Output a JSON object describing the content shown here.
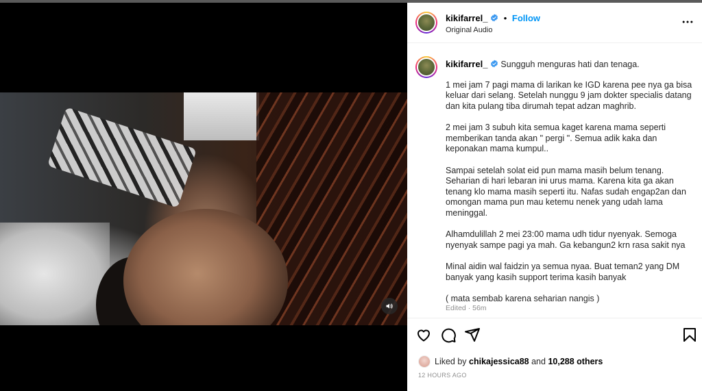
{
  "post": {
    "username": "kikifarrel_",
    "follow_label": "Follow",
    "header_separator": "•",
    "audio": "Original Audio",
    "caption": {
      "first": "Sungguh menguras hati dan tenaga.",
      "paragraphs": [
        "1 mei jam 7 pagi mama di larikan ke IGD karena pee nya ga bisa keluar dari selang. Setelah nunggu 9 jam dokter specialis datang dan kita pulang tiba dirumah tepat adzan maghrib.",
        "2 mei jam 3 subuh kita semua kaget karena mama seperti memberikan tanda akan \" pergi \". Semua adik kaka dan keponakan mama kumpul..",
        "Sampai setelah solat eid pun mama masih belum tenang. Seharian di hari lebaran ini urus mama. Karena kita ga akan tenang klo mama masih seperti itu. Nafas sudah engap2an dan omongan mama pun mau ketemu nenek yang udah lama meninggal.",
        "Alhamdulillah 2 mei 23:00 mama udh tidur nyenyak. Semoga nyenyak sampe pagi ya mah. Ga kebangun2 krn rasa sakit nya",
        "Minal aidin wal faidzin ya semua nyaa. Buat teman2 yang DM banyak yang kasih support terima kasih banyak",
        "( mata sembab karena seharian nangis )"
      ]
    },
    "edited": "Edited · 56m",
    "likes": {
      "prefix": "Liked by",
      "user": "chikajessica88",
      "and": "and",
      "count": "10,288 others"
    },
    "timestamp": "12 HOURS AGO"
  },
  "colors": {
    "accent": "#0095f6",
    "verified": "#3897f0"
  },
  "icons": [
    "verified-badge-icon",
    "more-options-icon",
    "heart-icon",
    "comment-icon",
    "share-icon",
    "bookmark-icon",
    "volume-icon"
  ]
}
